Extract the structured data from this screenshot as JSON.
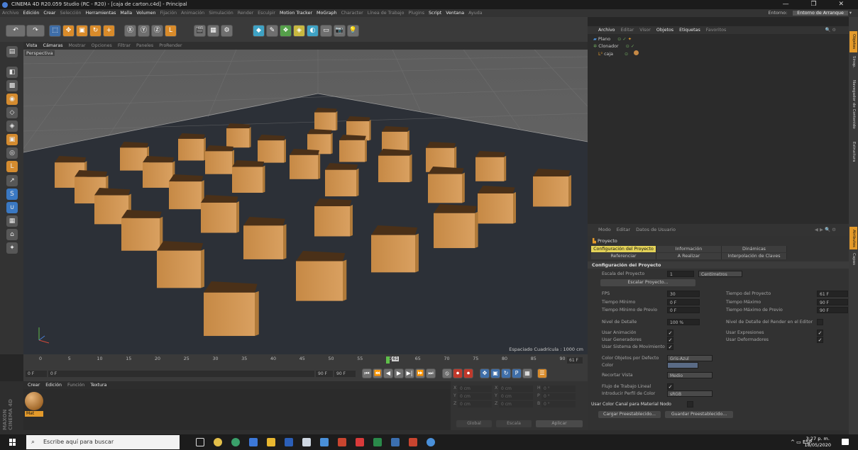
{
  "window": {
    "title": "CINEMA 4D R20.059 Studio (RC - R20) - [caja de carton.c4d] - Principal",
    "controls": "— ❐ ✕"
  },
  "menubar": {
    "items": [
      "Archivo",
      "Edición",
      "Crear",
      "Selección",
      "Herramientas",
      "Malla",
      "Volumen",
      "Fijación",
      "Animación",
      "Simulación",
      "Render",
      "Esculpir",
      "Motion Tracker",
      "MoGraph",
      "Character",
      "Línea de Trabajo",
      "Plugins",
      "Script",
      "Ventana",
      "Ayuda"
    ],
    "highlight": [
      1,
      2,
      4,
      5,
      6,
      12,
      13,
      17,
      18
    ],
    "env_label": "Entorno:",
    "env_value": "Entorno de Arranque"
  },
  "viewport": {
    "menu": [
      "Vista",
      "Cámaras",
      "Mostrar",
      "Opciones",
      "Filtrar",
      "Paneles",
      "ProRender"
    ],
    "name": "Perspectiva",
    "grid_info": "Espaciado Cuadrícula : 1000 cm"
  },
  "timeline": {
    "ticks": [
      "0",
      "5",
      "10",
      "15",
      "20",
      "25",
      "30",
      "35",
      "40",
      "45",
      "50",
      "55",
      "60",
      "61",
      "65",
      "70",
      "75",
      "80",
      "85",
      "90"
    ],
    "current": "61 F",
    "start": "0 F",
    "start2": "0 F",
    "end": "90 F",
    "end2": "90 F"
  },
  "materials": {
    "menu": [
      "Crear",
      "Edición",
      "Función",
      "Textura"
    ],
    "mat_name": "Mat",
    "brand": "MAXON CINEMA 4D"
  },
  "coords": {
    "rows": [
      [
        "X",
        "0 cm",
        "X",
        "0 cm",
        "H",
        "0 °"
      ],
      [
        "Y",
        "0 cm",
        "Y",
        "0 cm",
        "P",
        "0 °"
      ],
      [
        "Z",
        "0 cm",
        "Z",
        "0 cm",
        "B",
        "0 °"
      ]
    ],
    "mode1": "Global",
    "mode2": "Escala",
    "apply": "Aplicar"
  },
  "objects": {
    "menu": [
      "Archivo",
      "Editar",
      "Visor",
      "Objetos",
      "Etiquetas",
      "Favoritos"
    ],
    "items": [
      {
        "name": "Plano",
        "indent": 0
      },
      {
        "name": "Clonador",
        "indent": 0
      },
      {
        "name": "caja",
        "indent": 1
      }
    ]
  },
  "attributes": {
    "menu": [
      "Modo",
      "Editar",
      "Datos de Usuario"
    ],
    "object_name": "Proyecto",
    "tabs1": [
      "Configuración del Proyecto",
      "Información",
      "Dinámicas"
    ],
    "tabs2": [
      "Referenciar",
      "A Realizar",
      "Interpolación de Claves"
    ],
    "section": "Configuración del Proyecto",
    "scale_label": "Escala del Proyecto",
    "scale_value": "1",
    "scale_unit": "Centímetros",
    "scale_button": "Escalar Proyecto...",
    "fps_label": "FPS",
    "fps": "30",
    "proj_time_label": "Tiempo del Proyecto",
    "proj_time": "61 F",
    "min_time_label": "Tiempo Mínimo",
    "min_time": "0 F",
    "max_time_label": "Tiempo Máximo",
    "max_time": "90 F",
    "min_prev_label": "Tiempo Mínimo de Previo",
    "min_prev": "0 F",
    "max_prev_label": "Tiempo Máximo de Previo",
    "max_prev": "90 F",
    "lod_label": "Nivel de Detalle",
    "lod": "100 %",
    "lod_render_label": "Nivel de Detalle del Render en el Editor",
    "use_anim": "Usar Animación",
    "use_expr": "Usar Expresiones",
    "use_gen": "Usar Generadores",
    "use_deform": "Usar Deformadores",
    "use_motion": "Usar Sistema de Movimiento",
    "obj_color_label": "Color Objetos por Defecto",
    "obj_color": "Gris-Azul",
    "color_label": "Color",
    "clip_label": "Recortar Vista",
    "clip": "Medio",
    "linear_label": "Flujo de Trabajo Lineal",
    "input_label": "Introducir Perfil de Color",
    "input": "sRGB",
    "node_label": "Usar Color Canal para Material Nodo",
    "load_btn": "Cargar Preestablecido...",
    "save_btn": "Guardar Preestablecido..."
  },
  "right_tabs": [
    "Objetos",
    "Sinop.",
    "Navegador de Contenido",
    "Estructura",
    "Atributos",
    "Capas"
  ],
  "taskbar": {
    "search": "Escribe aquí para buscar",
    "lang": "ESP",
    "time": "3:27 p. m.",
    "date": "18/05/2020"
  }
}
